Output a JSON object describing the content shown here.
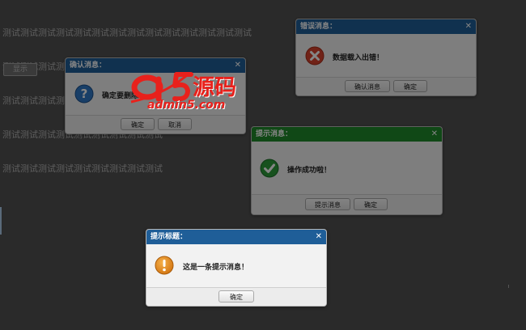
{
  "background": {
    "lines": [
      "测试测试测试测试测试测试测试测试测试测试测试测试测试测试",
      "测试测试测试测试测试测试测试测试测试测试测试测试",
      "测试测试测试测试测试测试测试测试测试测试测试测试",
      "测试测试测试测试测试测试测试测试测试",
      "测试测试测试测试测试测试测试测试测试"
    ],
    "button_label": "显示"
  },
  "confirm_dialog": {
    "title": "确认消息：",
    "message": "确定要删除",
    "ok_label": "确定",
    "cancel_label": "取消",
    "icon": "question-icon"
  },
  "error_dialog": {
    "title": "错误消息：",
    "message": "数据载入出错！",
    "cancel_msg_label": "确认消息",
    "ok_label": "确定",
    "icon": "error-icon"
  },
  "success_dialog": {
    "title": "提示消息：",
    "message": "操作成功啦！",
    "tip_label": "提示消息",
    "ok_label": "确定",
    "icon": "check-icon"
  },
  "info_dialog": {
    "title": "提示标题：",
    "message": "这是一条提示消息！",
    "ok_label": "确定",
    "icon": "warning-icon"
  },
  "watermark": {
    "brand": "源码",
    "site": "admin5.com"
  },
  "colors": {
    "header_blue": "#1f5e98",
    "header_green": "#1f8a2a",
    "logo_red": "#e8211c"
  }
}
